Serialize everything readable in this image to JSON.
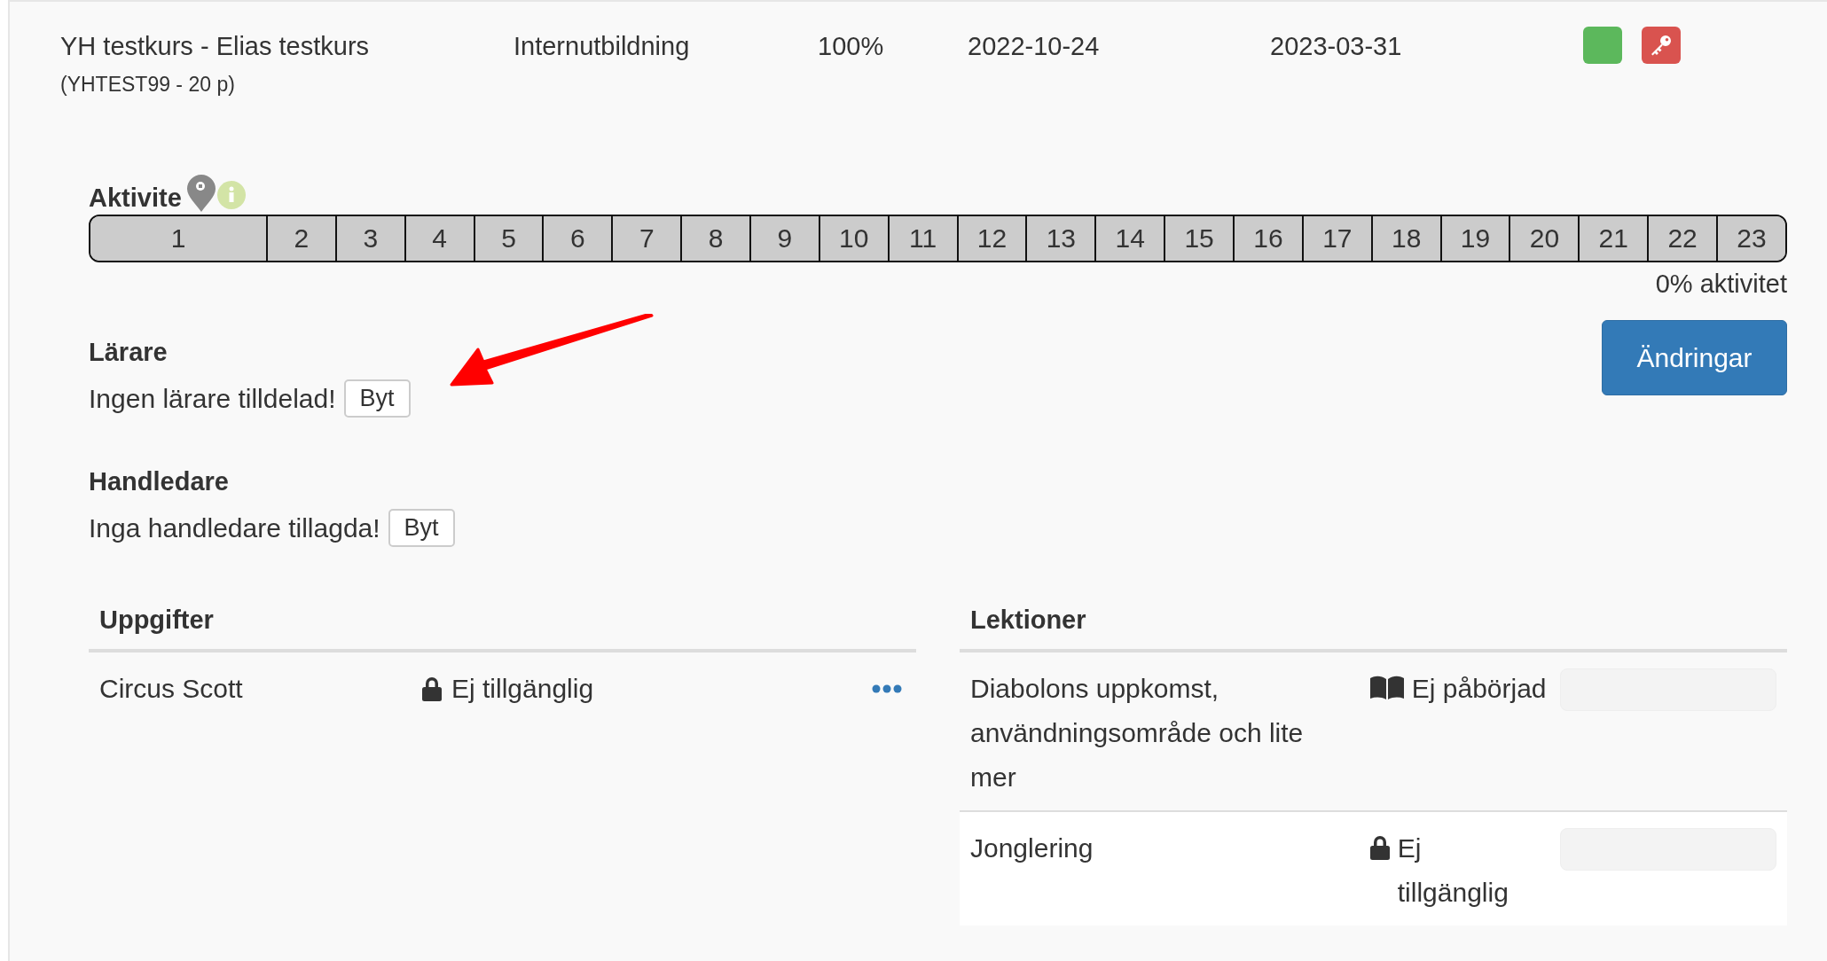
{
  "course": {
    "name": "YH testkurs - Elias testkurs",
    "code": "(YHTEST99 - 20 p)",
    "type": "Internutbildning",
    "progress": "100%",
    "start": "2022-10-24",
    "end": "2023-03-31"
  },
  "activity": {
    "heading": "Aktivite",
    "cells": [
      "1",
      "2",
      "3",
      "4",
      "5",
      "6",
      "7",
      "8",
      "9",
      "10",
      "11",
      "12",
      "13",
      "14",
      "15",
      "16",
      "17",
      "18",
      "19",
      "20",
      "21",
      "22",
      "23"
    ],
    "summary": "0% aktivitet"
  },
  "changes_button": "Ändringar",
  "teacher": {
    "heading": "Lärare",
    "text": "Ingen lärare tilldelad!",
    "button": "Byt"
  },
  "supervisor": {
    "heading": "Handledare",
    "text": "Inga handledare tillagda!",
    "button": "Byt"
  },
  "assignments": {
    "heading": "Uppgifter",
    "rows": [
      {
        "name": "Circus Scott",
        "kind": "lock",
        "status": "Ej tillgänglig"
      }
    ]
  },
  "lessons": {
    "heading": "Lektioner",
    "rows": [
      {
        "name": "Diabolons uppkomst, användningsområde och lite mer",
        "kind": "book",
        "status": "Ej påbörjad"
      },
      {
        "name": "Jonglering",
        "kind": "lock",
        "status": "Ej tillgänglig"
      }
    ]
  }
}
